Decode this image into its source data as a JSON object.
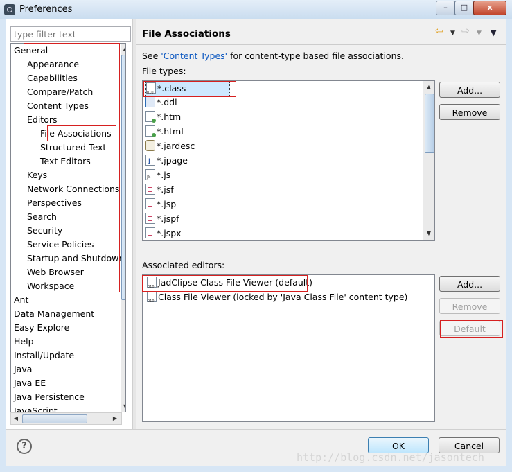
{
  "window": {
    "title": "Preferences",
    "minimize": "–",
    "maximize": "□",
    "close": "x"
  },
  "filter": {
    "placeholder": "type filter text"
  },
  "tree": {
    "items": [
      {
        "label": "General",
        "level": 0
      },
      {
        "label": "Appearance",
        "level": 1
      },
      {
        "label": "Capabilities",
        "level": 1
      },
      {
        "label": "Compare/Patch",
        "level": 1
      },
      {
        "label": "Content Types",
        "level": 1
      },
      {
        "label": "Editors",
        "level": 1
      },
      {
        "label": "File Associations",
        "level": 2,
        "selected": true
      },
      {
        "label": "Structured Text",
        "level": 2
      },
      {
        "label": "Text Editors",
        "level": 2
      },
      {
        "label": "Keys",
        "level": 1
      },
      {
        "label": "Network Connections",
        "level": 1
      },
      {
        "label": "Perspectives",
        "level": 1
      },
      {
        "label": "Search",
        "level": 1
      },
      {
        "label": "Security",
        "level": 1
      },
      {
        "label": "Service Policies",
        "level": 1
      },
      {
        "label": "Startup and Shutdown",
        "level": 1
      },
      {
        "label": "Web Browser",
        "level": 1
      },
      {
        "label": "Workspace",
        "level": 1
      },
      {
        "label": "Ant",
        "level": 0
      },
      {
        "label": "Data Management",
        "level": 0
      },
      {
        "label": "Easy Explore",
        "level": 0
      },
      {
        "label": "Help",
        "level": 0
      },
      {
        "label": "Install/Update",
        "level": 0
      },
      {
        "label": "Java",
        "level": 0
      },
      {
        "label": "Java EE",
        "level": 0
      },
      {
        "label": "Java Persistence",
        "level": 0
      },
      {
        "label": "JavaScript",
        "level": 0
      }
    ]
  },
  "page": {
    "title": "File Associations",
    "see_prefix": "See ",
    "link": "'Content Types'",
    "see_suffix": " for content-type based file associations.",
    "file_types_label": "File types:",
    "file_types": [
      {
        "label": "*.class",
        "icon": "class-file-icon",
        "selected": true
      },
      {
        "label": "*.ddl",
        "icon": "ddl-file-icon"
      },
      {
        "label": "*.htm",
        "icon": "web-file-icon"
      },
      {
        "label": "*.html",
        "icon": "web-file-icon"
      },
      {
        "label": "*.jardesc",
        "icon": "jar-desc-icon"
      },
      {
        "label": "*.jpage",
        "icon": "java-page-icon"
      },
      {
        "label": "*.js",
        "icon": "javascript-file-icon"
      },
      {
        "label": "*.jsf",
        "icon": "text-file-icon"
      },
      {
        "label": "*.jsp",
        "icon": "text-file-icon"
      },
      {
        "label": "*.jspf",
        "icon": "text-file-icon"
      },
      {
        "label": "*.jspx",
        "icon": "text-file-icon"
      }
    ],
    "assoc_label": "Associated editors:",
    "editors": [
      {
        "label": "JadClipse Class File Viewer (default)",
        "icon": "class-file-icon"
      },
      {
        "label": "Class File Viewer (locked by 'Java Class File' content type)",
        "icon": "class-file-icon"
      }
    ],
    "buttons": {
      "add": "Add...",
      "remove": "Remove",
      "add2": "Add...",
      "remove2": "Remove",
      "default": "Default"
    },
    "nav_icons": [
      "back-arrow-icon",
      "menu-down-icon",
      "forward-arrow-icon",
      "menu-down-icon",
      "view-menu-icon"
    ]
  },
  "footer": {
    "ok": "OK",
    "cancel": "Cancel",
    "watermark": "http://blog.csdn.net/jasontech"
  }
}
